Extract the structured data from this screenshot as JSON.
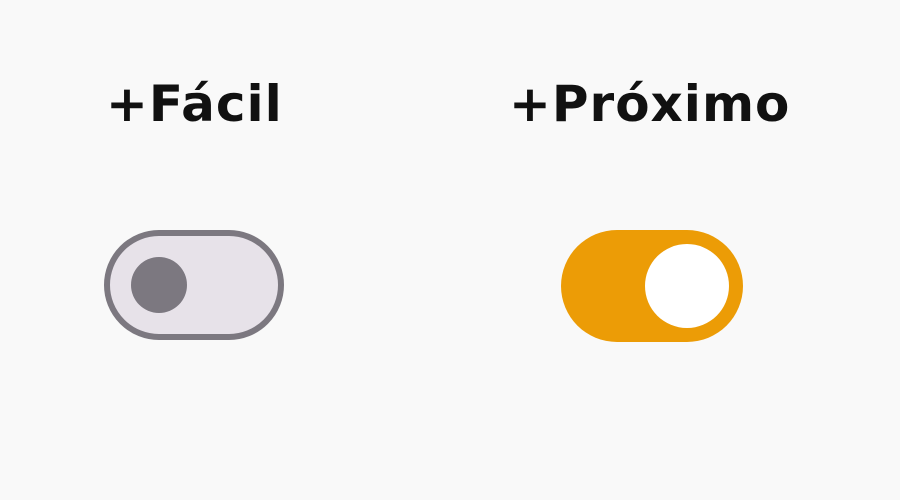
{
  "toggles": [
    {
      "label": "+Fácil",
      "state": "off",
      "track_color": "#e7e2e9",
      "border_color": "#7c7880",
      "knob_color": "#7c7880"
    },
    {
      "label": "+Próximo",
      "state": "on",
      "track_color": "#ec9c06",
      "knob_color": "#ffffff"
    }
  ],
  "colors": {
    "background": "#f9f9f9",
    "text": "#111111"
  }
}
